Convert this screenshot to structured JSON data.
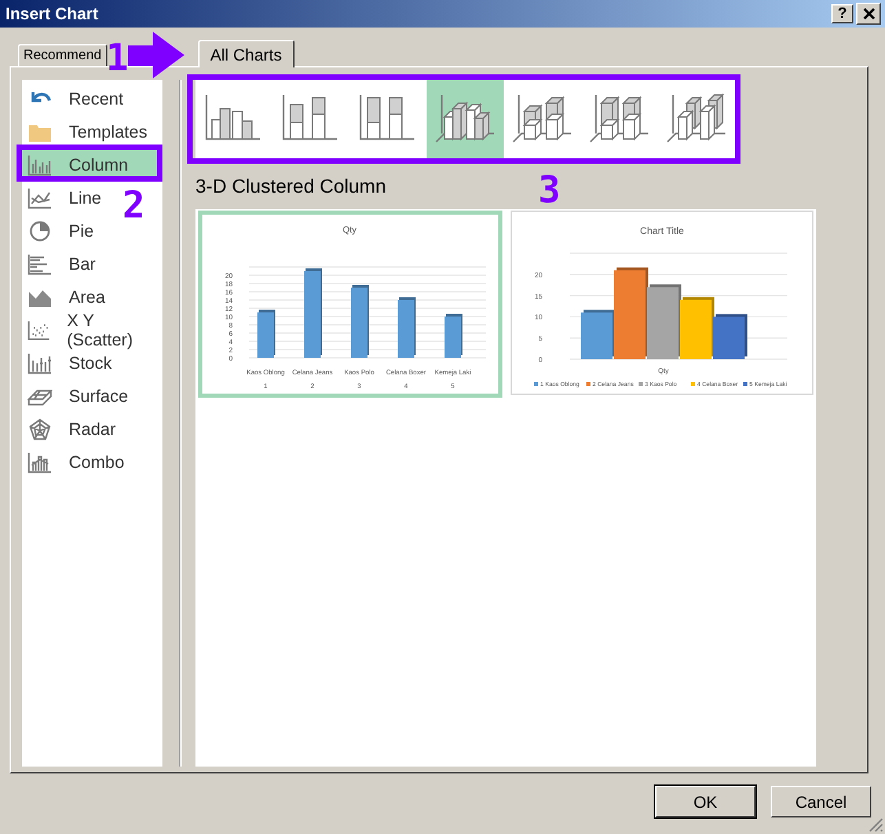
{
  "window": {
    "title": "Insert Chart",
    "help_button": "?"
  },
  "tabs": [
    {
      "label": "Recommend",
      "selected": false
    },
    {
      "label": "All Charts",
      "selected": true
    }
  ],
  "chart_types": [
    {
      "label": "Recent",
      "selected": false
    },
    {
      "label": "Templates",
      "selected": false
    },
    {
      "label": "Column",
      "selected": true
    },
    {
      "label": "Line",
      "selected": false
    },
    {
      "label": "Pie",
      "selected": false
    },
    {
      "label": "Bar",
      "selected": false
    },
    {
      "label": "Area",
      "selected": false
    },
    {
      "label": "X Y (Scatter)",
      "selected": false
    },
    {
      "label": "Stock",
      "selected": false
    },
    {
      "label": "Surface",
      "selected": false
    },
    {
      "label": "Radar",
      "selected": false
    },
    {
      "label": "Combo",
      "selected": false
    }
  ],
  "subtypes": [
    {
      "selected": false
    },
    {
      "selected": false
    },
    {
      "selected": false
    },
    {
      "selected": true
    },
    {
      "selected": false
    },
    {
      "selected": false
    },
    {
      "selected": false
    }
  ],
  "subtype_title": "3-D Clustered Column",
  "previews": [
    {
      "selected": true,
      "axis_numbers": [
        "1",
        "2",
        "3",
        "4",
        "5"
      ],
      "chart_data": {
        "type": "bar",
        "title": "Qty",
        "categories": [
          "Kaos Oblong",
          "Celana Jeans",
          "Kaos Polo",
          "Celana Boxer",
          "Kemeja Laki"
        ],
        "series": [
          {
            "color": "#5b9bd5",
            "values": [
              11,
              21,
              17,
              14,
              10
            ]
          }
        ],
        "ylim": [
          0,
          22
        ],
        "grid": true,
        "yticks": [
          0,
          2,
          4,
          6,
          8,
          10,
          12,
          14,
          16,
          18,
          20
        ]
      }
    },
    {
      "selected": false,
      "chart_data": {
        "type": "bar",
        "title": "Chart Title",
        "xlabel": "Qty",
        "legend": "bottom",
        "grid": true,
        "series": [
          {
            "name": "1 Kaos Oblong",
            "color": "#5b9bd5",
            "values": [
              11
            ]
          },
          {
            "name": "2 Celana Jeans",
            "color": "#ed7d31",
            "values": [
              21
            ]
          },
          {
            "name": "3 Kaos Polo",
            "color": "#a5a5a5",
            "values": [
              17
            ]
          },
          {
            "name": "4 Celana Boxer",
            "color": "#ffc000",
            "values": [
              14
            ]
          },
          {
            "name": "5 Kemeja Laki",
            "color": "#4472c4",
            "values": [
              10
            ]
          }
        ],
        "ylim": [
          0,
          25
        ],
        "yticks": [
          0,
          5,
          10,
          15,
          20
        ]
      }
    }
  ],
  "buttons": [
    {
      "label": "OK",
      "default": true
    },
    {
      "label": "Cancel",
      "default": false
    }
  ],
  "annotations": [
    {
      "label": "1"
    },
    {
      "label": "2"
    },
    {
      "label": "3"
    }
  ]
}
